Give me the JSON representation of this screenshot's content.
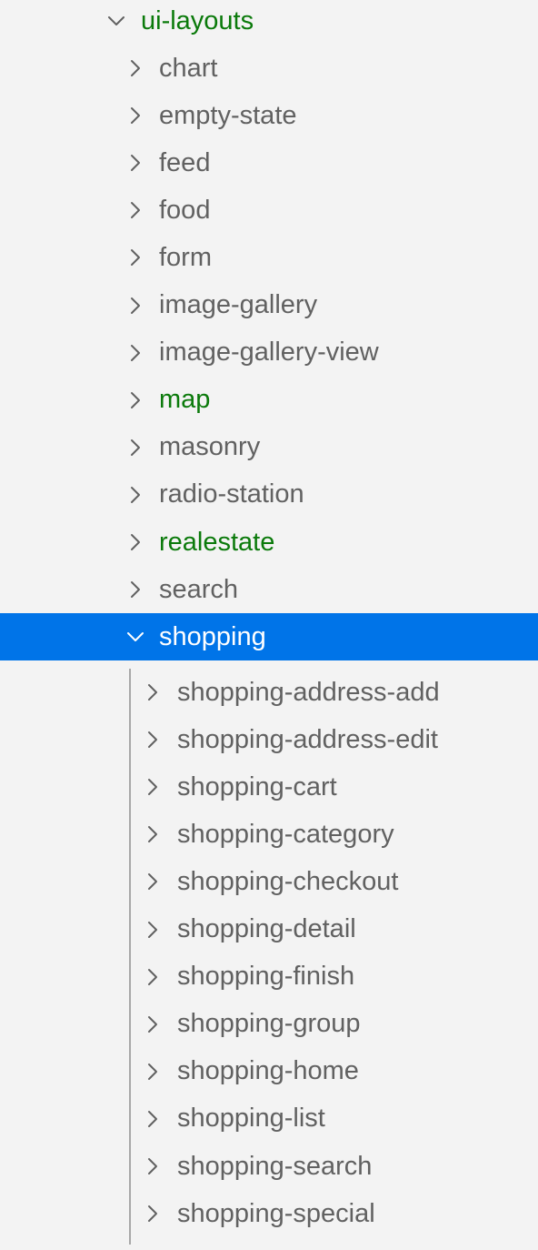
{
  "colors": {
    "selected_bg": "#0074e8",
    "git_added": "#0b7a0b",
    "text": "#616161"
  },
  "tree": {
    "root": {
      "label": "ui-layouts",
      "expanded": true,
      "status": "added"
    },
    "children": [
      {
        "label": "chart",
        "expanded": false,
        "status": ""
      },
      {
        "label": "empty-state",
        "expanded": false,
        "status": ""
      },
      {
        "label": "feed",
        "expanded": false,
        "status": ""
      },
      {
        "label": "food",
        "expanded": false,
        "status": ""
      },
      {
        "label": "form",
        "expanded": false,
        "status": ""
      },
      {
        "label": "image-gallery",
        "expanded": false,
        "status": ""
      },
      {
        "label": "image-gallery-view",
        "expanded": false,
        "status": ""
      },
      {
        "label": "map",
        "expanded": false,
        "status": "added"
      },
      {
        "label": "masonry",
        "expanded": false,
        "status": ""
      },
      {
        "label": "radio-station",
        "expanded": false,
        "status": ""
      },
      {
        "label": "realestate",
        "expanded": false,
        "status": "added"
      },
      {
        "label": "search",
        "expanded": false,
        "status": ""
      },
      {
        "label": "shopping",
        "expanded": true,
        "status": "selected"
      }
    ],
    "shopping_children": [
      {
        "label": "shopping-address-add"
      },
      {
        "label": "shopping-address-edit"
      },
      {
        "label": "shopping-cart"
      },
      {
        "label": "shopping-category"
      },
      {
        "label": "shopping-checkout"
      },
      {
        "label": "shopping-detail"
      },
      {
        "label": "shopping-finish"
      },
      {
        "label": "shopping-group"
      },
      {
        "label": "shopping-home"
      },
      {
        "label": "shopping-list"
      },
      {
        "label": "shopping-search"
      },
      {
        "label": "shopping-special"
      }
    ]
  }
}
